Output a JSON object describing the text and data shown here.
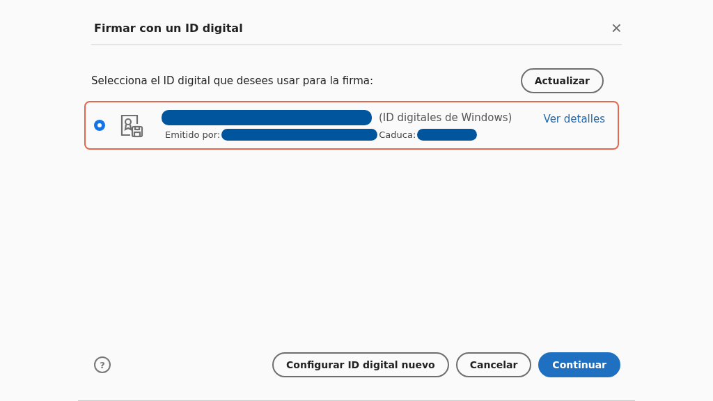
{
  "dialog": {
    "title": "Firmar con un ID digital",
    "close": "×"
  },
  "prompt": "Selecciona el ID digital que desees usar para la firma:",
  "refresh_button": "Actualizar",
  "ids": [
    {
      "selected": true,
      "store": "(ID digitales de Windows)",
      "issued_label": "Emitido por:",
      "expires_label": "Caduca:",
      "details_link": "Ver detalles"
    }
  ],
  "buttons": [
    {
      "kind": "secondary",
      "label": "Configurar ID digital nuevo"
    },
    {
      "kind": "secondary",
      "label": "Cancelar"
    },
    {
      "kind": "primary",
      "label": "Continuar"
    }
  ],
  "help": "?"
}
